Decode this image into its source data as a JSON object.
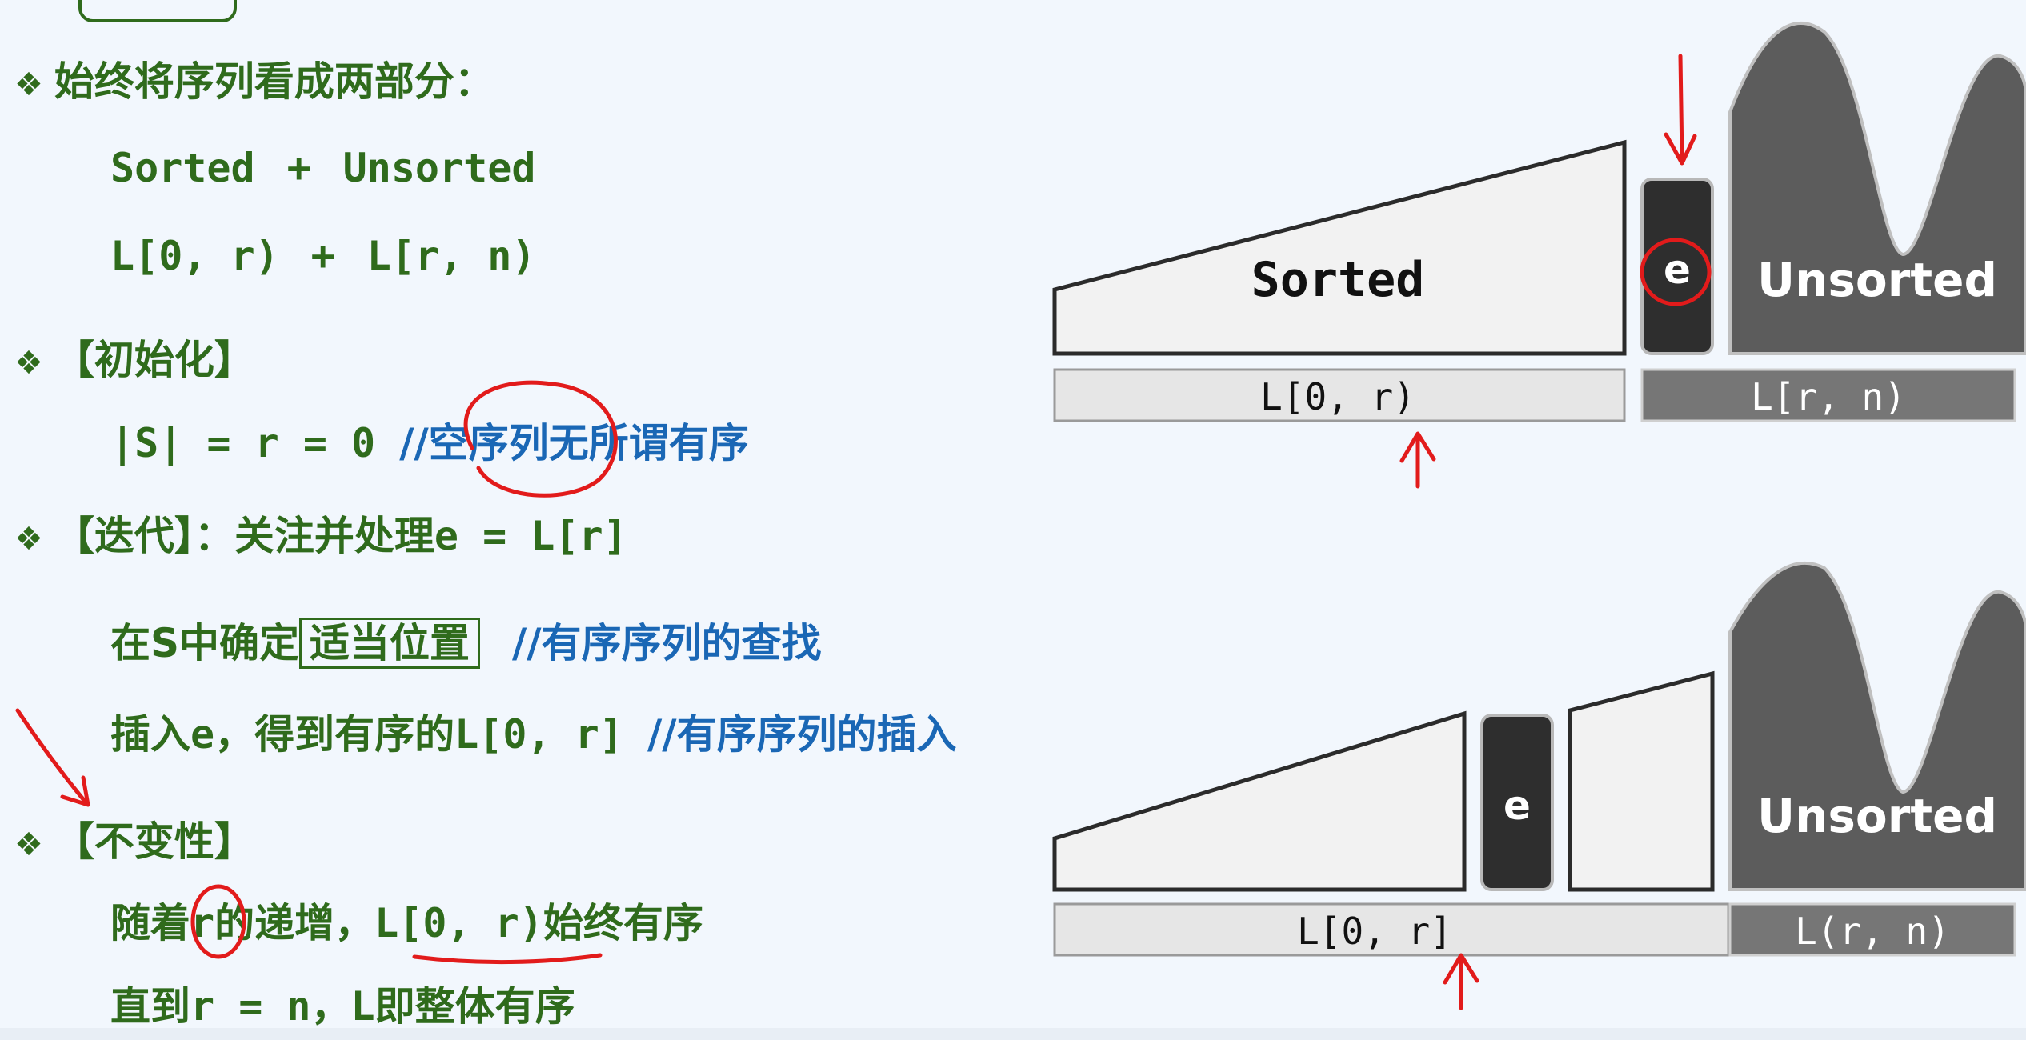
{
  "left": {
    "b1": {
      "text": "始终将序列看成两部分："
    },
    "b1_line1": {
      "a": "Sorted",
      "plus": "+",
      "b": "Unsorted"
    },
    "b1_line2": {
      "a": "L[0, r)",
      "plus": "+",
      "b": "L[r, n)"
    },
    "b2": {
      "text": "【初始化】"
    },
    "b2_line": {
      "code": "|S| = r = 0 ",
      "comment": "//空序列无所谓有序"
    },
    "b3": {
      "head": "【迭代】：关注并处理",
      "code": "e = L[r]"
    },
    "b3_line1": {
      "pre": "在S中确定",
      "boxed": "适当位置",
      "comment": "//有序序列的查找"
    },
    "b3_line2": {
      "pre": "插入",
      "e": "e",
      "mid": "，得到有序的",
      "code": "L[0, r] ",
      "comment": "//有序序列的插入"
    },
    "b4": {
      "text": "【不变性】"
    },
    "b4_line1": {
      "pre": "随着",
      "r": "r",
      "mid": "的递增，",
      "code": "L[0, r)",
      "post": "始终有序"
    },
    "b4_line2": {
      "pre": "直到",
      "code": "r = n",
      "mid": "，",
      "L": "L",
      "post": "即整体有序"
    }
  },
  "diagram_top": {
    "sorted": "Sorted",
    "e": "e",
    "unsorted": "Unsorted",
    "left_label": "L[0, r)",
    "right_label": "L[r, n)"
  },
  "diagram_bottom": {
    "e": "e",
    "unsorted": "Unsorted",
    "left_label": "L[0, r]",
    "right_label": "L(r, n)"
  },
  "colors": {
    "green": "#2f6b1c",
    "blue": "#1a67b5",
    "red": "#e21b1b",
    "dark": "#5a5a5a"
  }
}
